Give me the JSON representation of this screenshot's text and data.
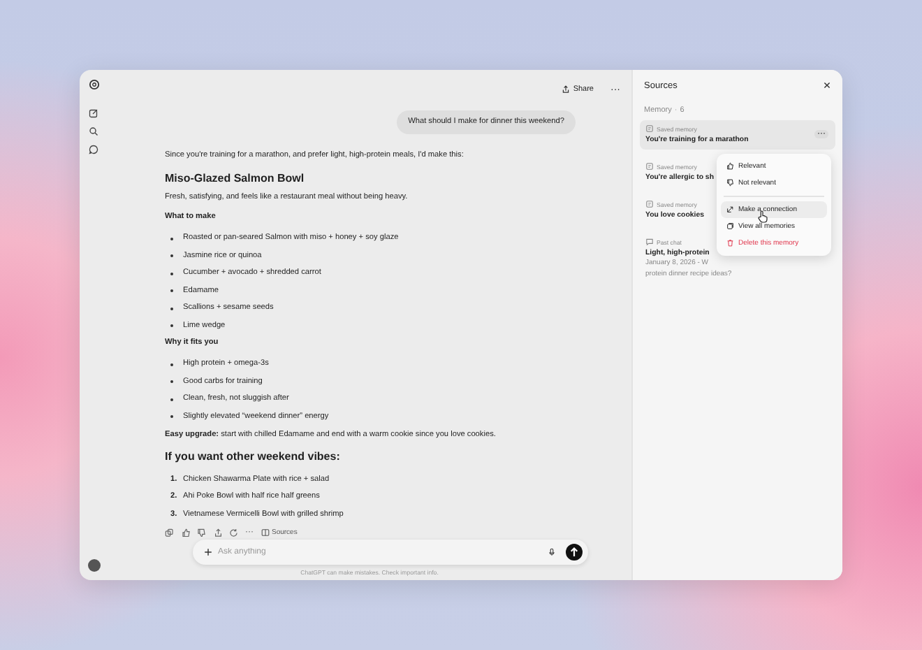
{
  "header": {
    "share": "Share",
    "more": "···"
  },
  "user_message": "What should I make for dinner this weekend?",
  "answer": [
    {
      "kind": "paragraph",
      "text": "Since you're training for a marathon, and prefer light, high-protein meals, I'd make this:"
    },
    {
      "kind": "title",
      "text": "Miso-Glazed Salmon Bowl"
    },
    {
      "kind": "paragraph",
      "text": "Fresh, satisfying, and feels like a restaurant meal without being heavy."
    },
    {
      "kind": "subheading",
      "text": "What to make"
    },
    {
      "kind": "bullets",
      "items": [
        "Roasted or pan-seared Salmon with miso + honey + soy glaze",
        "Jasmine rice or quinoa",
        "Cucumber + avocado + shredded carrot",
        "Edamame",
        "Scallions + sesame seeds",
        "Lime wedge"
      ]
    },
    {
      "kind": "subheading",
      "text": "Why it fits you"
    },
    {
      "kind": "bullets",
      "items": [
        "High protein + omega-3s",
        "Good carbs for training",
        "Clean, fresh, not sluggish after",
        "Slightly elevated “weekend dinner” energy"
      ]
    },
    {
      "kind": "paragraph",
      "text": "**Easy upgrade:** start with chilled Edamame and end with a warm cookie since you love cookies."
    },
    {
      "kind": "title",
      "text": "If you want other weekend vibes:"
    },
    {
      "kind": "numbered",
      "items": [
        {
          "num": "1.",
          "text": "Chicken Shawarma Plate with rice + salad"
        },
        {
          "num": "2.",
          "text": "Ahi Poke Bowl with half rice half greens"
        },
        {
          "num": "3.",
          "text": "Vietnamese Vermicelli Bowl with grilled shrimp"
        }
      ]
    }
  ],
  "actions": {
    "more": "···",
    "sources": "Sources"
  },
  "composer": {
    "placeholder": "Ask anything"
  },
  "disclaimer": "ChatGPT can make mistakes. Check important info.",
  "sources_panel": {
    "title": "Sources",
    "section": "Memory",
    "separator": "·",
    "count": "6",
    "items": [
      {
        "kind": "memory",
        "label": "Saved memory",
        "title": "You're training for a marathon",
        "selected": true
      },
      {
        "kind": "memory",
        "label": "Saved memory",
        "title": "You're allergic to sh",
        "selected": false
      },
      {
        "kind": "memory",
        "label": "Saved memory",
        "title": "You love cookies",
        "selected": false
      },
      {
        "kind": "chat",
        "label": "Past chat",
        "title": "Light, high-protein",
        "detail": [
          "January 8, 2026 - W",
          "protein dinner recipe ideas?"
        ],
        "selected": false
      }
    ]
  },
  "context_menu": [
    {
      "kind": "thumb-up",
      "label": "Relevant",
      "selected": false,
      "danger": false
    },
    {
      "kind": "thumb-down",
      "label": "Not relevant",
      "selected": false,
      "danger": false
    },
    {
      "kind": "link",
      "label": "Make a connection",
      "selected": true,
      "danger": false
    },
    {
      "kind": "memories",
      "label": "View all memories",
      "selected": false,
      "danger": false
    },
    {
      "kind": "trash",
      "label": "Delete this memory",
      "selected": false,
      "danger": true
    }
  ]
}
